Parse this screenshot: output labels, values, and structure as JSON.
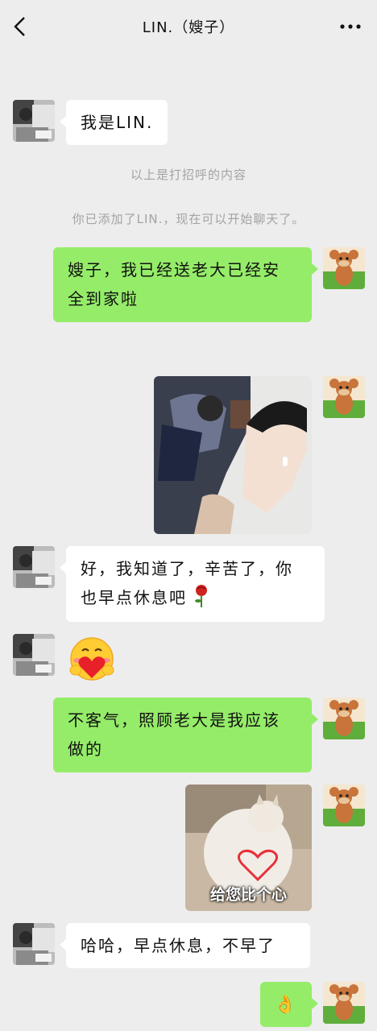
{
  "header": {
    "title": "LIN.（嫂子）",
    "back_icon": "chevron-left-icon",
    "more_icon": "more-dots-icon"
  },
  "messages": [
    {
      "side": "left",
      "type": "text",
      "text": "我是LIN."
    },
    {
      "side": "system",
      "type": "system",
      "text": "以上是打招呼的内容"
    },
    {
      "side": "system",
      "type": "system",
      "text": "你已添加了LIN.，现在可以开始聊天了。"
    },
    {
      "side": "right",
      "type": "text",
      "text_lines": [
        "嫂子，我已经送老大已经安",
        "全到家啦"
      ]
    },
    {
      "side": "right",
      "type": "image",
      "image": "photo-of-people-in-car"
    },
    {
      "side": "left",
      "type": "text",
      "text_lines": [
        "好，我知道了，辛苦了，你",
        "也早点休息吧"
      ],
      "emoji": "rose-emoji"
    },
    {
      "side": "left",
      "type": "sticker",
      "sticker": "heart-hug-emoji"
    },
    {
      "side": "right",
      "type": "text",
      "text_lines": [
        "不客气，照顾老大是我应该",
        "做的"
      ]
    },
    {
      "side": "right",
      "type": "image",
      "image": "cat-gif-sticker",
      "caption": "给您比个心"
    },
    {
      "side": "left",
      "type": "text",
      "text": "哈哈，早点休息，不早了"
    },
    {
      "side": "right",
      "type": "text",
      "text": "👌",
      "emoji": "ok-hand-emoji"
    }
  ],
  "colors": {
    "background": "#ededed",
    "bubble_green": "#95ec69",
    "bubble_white": "#ffffff",
    "system_text": "#a3a3a3"
  }
}
